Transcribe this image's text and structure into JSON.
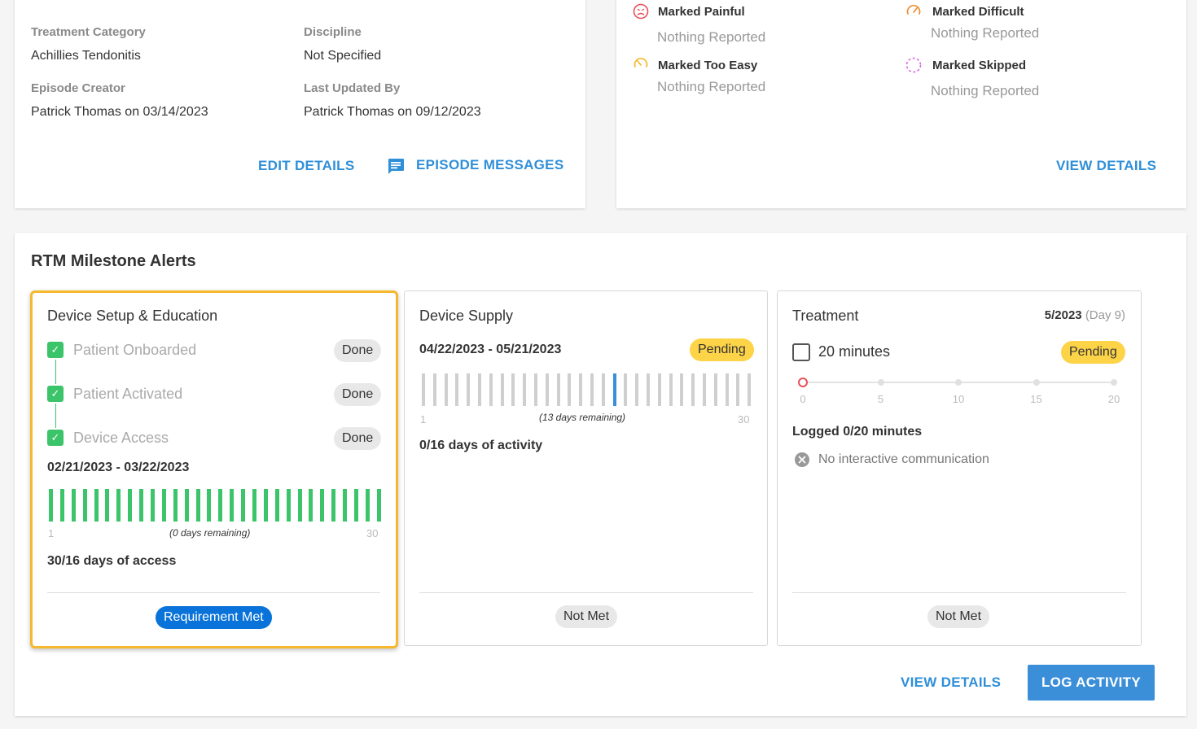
{
  "details": {
    "treatment_category_label": "Treatment Category",
    "treatment_category_value": "Achillies Tendonitis",
    "discipline_label": "Discipline",
    "discipline_value": "Not Specified",
    "episode_creator_label": "Episode Creator",
    "episode_creator_value": "Patrick Thomas on 03/14/2023",
    "last_updated_label": "Last Updated By",
    "last_updated_value": "Patrick Thomas on 09/12/2023",
    "edit_details": "EDIT DETAILS",
    "episode_messages": "EPISODE MESSAGES"
  },
  "feedback": {
    "items": [
      {
        "title": "Marked Painful",
        "value": "Nothing Reported",
        "icon": "frown-face-icon",
        "color": "#e8505b"
      },
      {
        "title": "Marked Difficult",
        "value": "Nothing Reported",
        "icon": "gauge-high-icon",
        "color": "#f08c2e"
      },
      {
        "title": "Marked Too Easy",
        "value": "Nothing Reported",
        "icon": "gauge-low-icon",
        "color": "#f5b82e"
      },
      {
        "title": "Marked Skipped",
        "value": "Nothing Reported",
        "icon": "dashed-circle-icon",
        "color": "#d46be0"
      }
    ],
    "view_details": "VIEW DETAILS"
  },
  "rtm": {
    "title": "RTM Milestone Alerts",
    "device_setup": {
      "title": "Device Setup & Education",
      "steps": [
        {
          "label": "Patient Onboarded",
          "status": "Done"
        },
        {
          "label": "Patient Activated",
          "status": "Done"
        },
        {
          "label": "Device Access",
          "status": "Done"
        }
      ],
      "date_range": "02/21/2023 - 03/22/2023",
      "days_filled": 30,
      "days_total": 30,
      "axis_start": "1",
      "axis_end": "30",
      "remaining": "(0 days remaining)",
      "summary": "30/16 days of access",
      "status": "Requirement Met",
      "bar_color": "#3cc46a"
    },
    "device_supply": {
      "title": "Device Supply",
      "date_range": "04/22/2023 - 05/21/2023",
      "badge": "Pending",
      "days_total": 30,
      "current_day": 18,
      "axis_start": "1",
      "axis_end": "30",
      "remaining": "(13 days remaining)",
      "summary": "0/16 days of activity",
      "status": "Not Met",
      "bar_color": "#cfcfcf",
      "current_color": "#3b8fd9"
    },
    "treatment": {
      "title": "Treatment",
      "date": "5/2023",
      "day": "(Day 9)",
      "checkbox_label": "20 minutes",
      "badge": "Pending",
      "scale": [
        "0",
        "5",
        "10",
        "15",
        "20"
      ],
      "logged_minutes": 0,
      "logged": "Logged 0/20 minutes",
      "communication": "No interactive communication",
      "status": "Not Met"
    },
    "view_details": "VIEW DETAILS",
    "log_activity": "LOG ACTIVITY"
  }
}
